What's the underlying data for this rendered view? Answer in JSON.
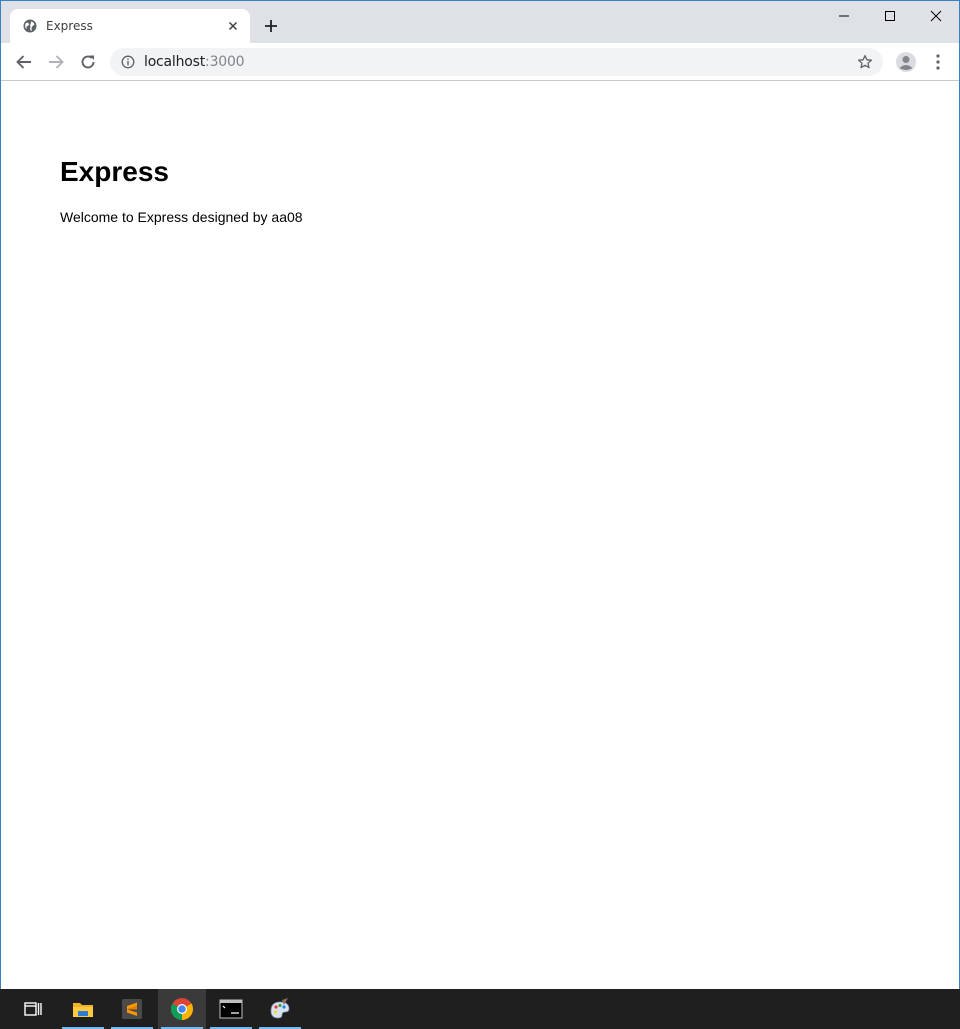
{
  "browser": {
    "tab": {
      "title": "Express",
      "favicon": "globe-icon"
    },
    "address": {
      "host": "localhost",
      "port": ":3000"
    },
    "icons": {
      "back": "arrow-left-icon",
      "forward": "arrow-right-icon",
      "reload": "reload-icon",
      "info": "info-icon",
      "bookmark": "star-icon",
      "profile": "avatar-icon",
      "menu": "more-vertical-icon",
      "new_tab": "plus-icon",
      "tab_close": "close-icon"
    }
  },
  "page": {
    "title": "Express",
    "text": "Welcome to Express designed by aa08"
  },
  "taskbar": {
    "items": [
      {
        "name": "task-view-icon"
      },
      {
        "name": "file-explorer-icon"
      },
      {
        "name": "sublime-text-icon"
      },
      {
        "name": "chrome-icon",
        "active": true
      },
      {
        "name": "command-prompt-icon"
      },
      {
        "name": "paint-icon"
      }
    ],
    "accent": "#76b9ed"
  }
}
